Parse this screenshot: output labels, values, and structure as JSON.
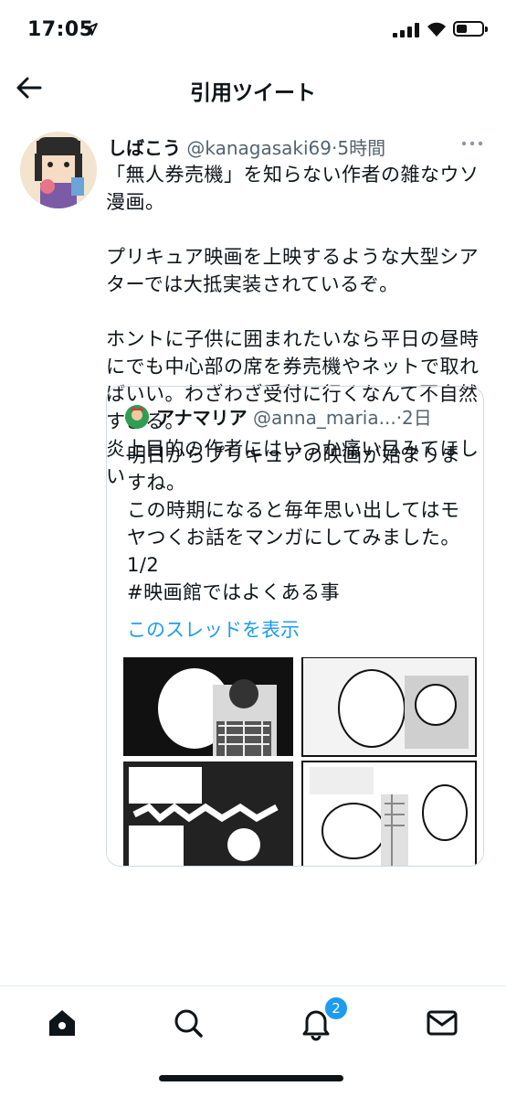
{
  "status": {
    "time": "17:05"
  },
  "header": {
    "title": "引用ツイート"
  },
  "tweet": {
    "display_name": "しばこう",
    "handle": "@kanagasaki69",
    "meta": "·5時間",
    "text": "「無人券売機」を知らない作者の雑なウソ漫画。\n\nプリキュア映画を上映するような大型シアターでは大抵実装されているぞ。\n\nホントに子供に囲まれたいなら平日の昼時にでも中心部の席を券売機やネットで取ればいい。わざわざ受付に行くなんて不自然すぎる。\n炎上目的の作者にはいつか痛い目みてほしい"
  },
  "quoted": {
    "display_name": "アナマリア",
    "handle": "@anna_maria...",
    "meta": "·2日",
    "text": "明日からプリキュアの映画が始まりますね。\nこの時期になると毎年思い出してはモヤつくお話をマンガにしてみました。1/2\n#映画館ではよくある事",
    "thread_link": "このスレッドを表示"
  },
  "tabbar": {
    "notification_count": "2"
  },
  "colors": {
    "accent": "#1d9bf0",
    "text": "#0f1419",
    "secondary": "#536471",
    "border": "#cfd9de"
  },
  "icons": [
    "location-arrow-icon",
    "signal-icon",
    "wifi-icon",
    "battery-icon",
    "back-arrow-icon",
    "more-icon",
    "home-icon",
    "search-icon",
    "bell-icon",
    "mail-icon"
  ]
}
